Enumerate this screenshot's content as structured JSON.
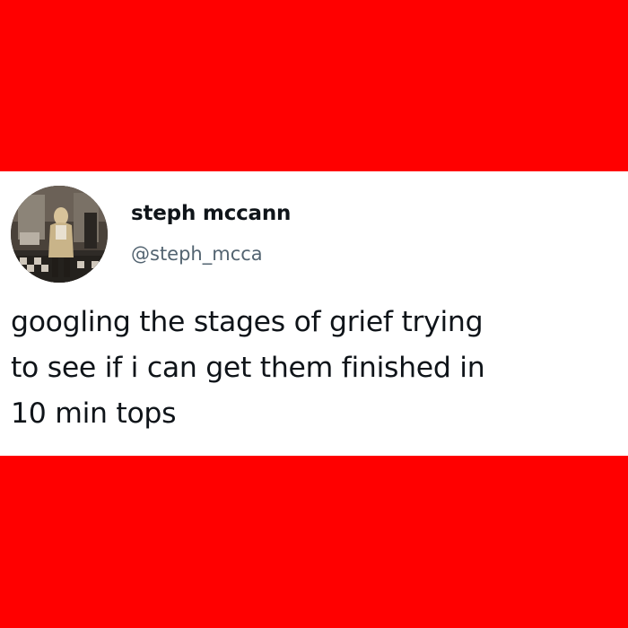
{
  "colors": {
    "frame_background": "#ff0000",
    "card_background": "#ffffff",
    "name_color": "#0f1419",
    "handle_color": "#536471"
  },
  "tweet": {
    "avatar_icon": "user-photo-avatar",
    "display_name": "steph mccann",
    "handle": "@steph_mcca",
    "text_lines": [
      "googling the stages of grief trying",
      "to see if i can get them finished in",
      "10 min tops"
    ]
  }
}
